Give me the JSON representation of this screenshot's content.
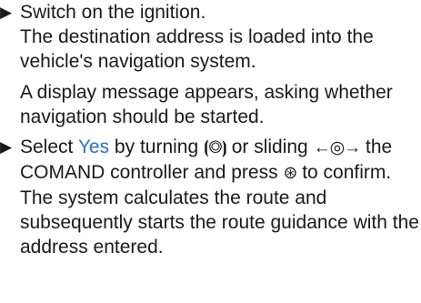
{
  "steps": [
    {
      "bullet": "▶",
      "action": "Switch on the ignition.",
      "results": [
        "The destination address is loaded into the vehicle's navigation system.",
        "A display message appears, asking whether navigation should be started."
      ]
    },
    {
      "bullet": "▶",
      "action_prefix": "Select ",
      "action_highlight": "Yes",
      "action_mid": " by turning ",
      "turn_symbol": "⦗◎⦘",
      "action_mid2": " or sliding ",
      "slide_symbol": "←◎→",
      "action_mid3": " the COMAND controller and press ",
      "press_symbol": "⊛",
      "action_suffix": " to confirm.",
      "result": "The system calculates the route and subsequently starts the route guidance with the address entered."
    }
  ],
  "colors": {
    "highlight": "#2a73c9",
    "text": "#1a1a1a"
  }
}
